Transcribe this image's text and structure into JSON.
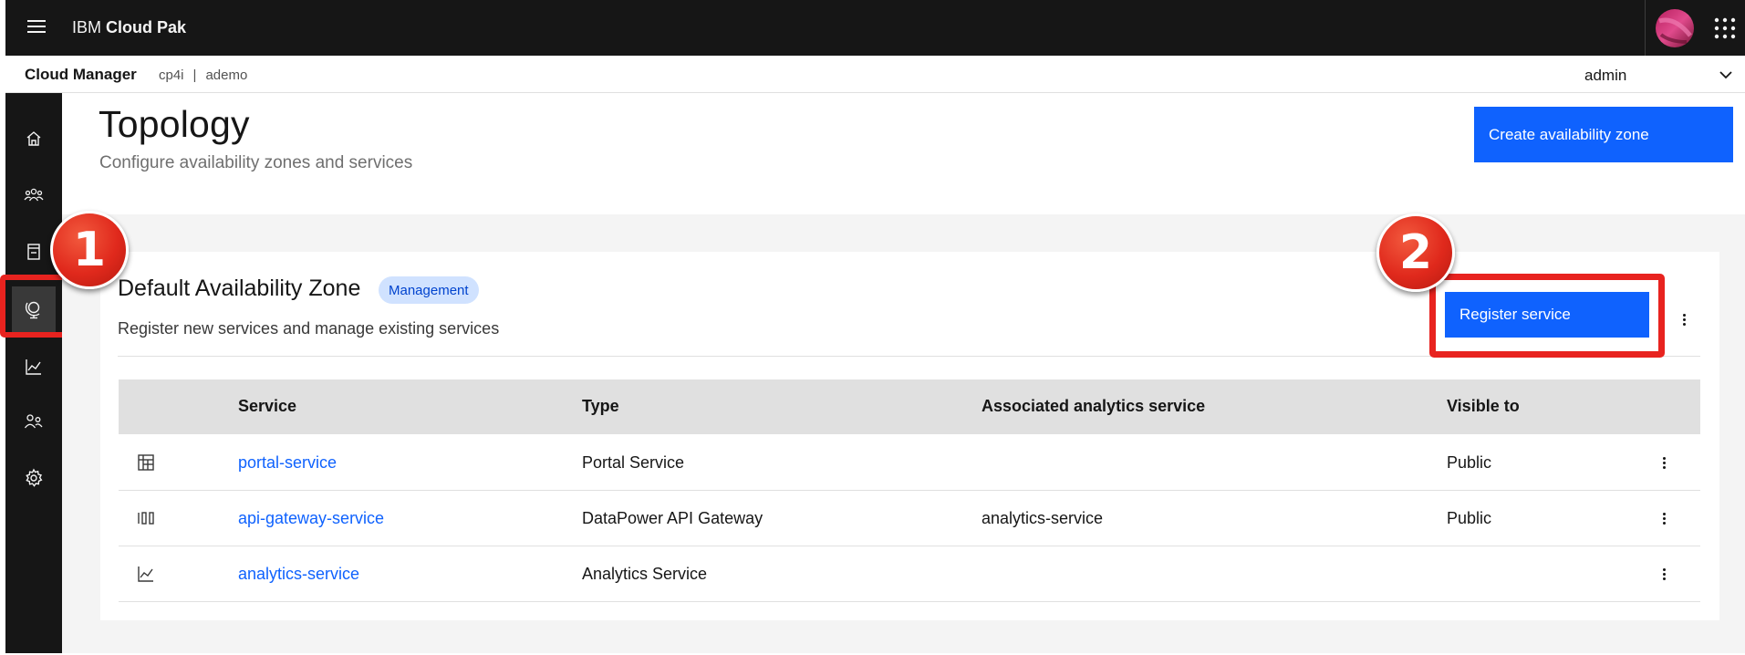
{
  "header": {
    "brand_prefix": "IBM",
    "brand_name": "Cloud Pak"
  },
  "subheader": {
    "title": "Cloud Manager",
    "crumb_1": "cp4i",
    "separator": "|",
    "crumb_2": "ademo",
    "user": "admin"
  },
  "nav": {
    "items": [
      {
        "icon": "home-icon"
      },
      {
        "icon": "users-icon"
      },
      {
        "icon": "resources-icon"
      },
      {
        "icon": "topology-globe-icon",
        "active": true
      },
      {
        "icon": "analytics-icon"
      },
      {
        "icon": "members-icon"
      },
      {
        "icon": "settings-icon"
      }
    ]
  },
  "page": {
    "title": "Topology",
    "subtitle": "Configure availability zones and services",
    "create_button": "Create availability zone"
  },
  "zone": {
    "title": "Default Availability Zone",
    "tag": "Management",
    "subtitle": "Register new services and manage existing services",
    "register_button": "Register service"
  },
  "table": {
    "headers": [
      "Service",
      "Type",
      "Associated analytics service",
      "Visible to"
    ],
    "rows": [
      {
        "icon": "portal-icon",
        "service": "portal-service",
        "type": "Portal Service",
        "analytics": "",
        "visible": "Public"
      },
      {
        "icon": "gateway-icon",
        "service": "api-gateway-service",
        "type": "DataPower API Gateway",
        "analytics": "analytics-service",
        "visible": "Public"
      },
      {
        "icon": "analytics-chart-icon",
        "service": "analytics-service",
        "type": "Analytics Service",
        "analytics": "",
        "visible": ""
      }
    ]
  },
  "callouts": {
    "one": "1",
    "two": "2"
  },
  "colors": {
    "topbar": "#161616",
    "primary": "#0f62fe",
    "highlight": "#e8231f",
    "tag_bg": "#d0e2ff",
    "link": "#0f62fe"
  }
}
